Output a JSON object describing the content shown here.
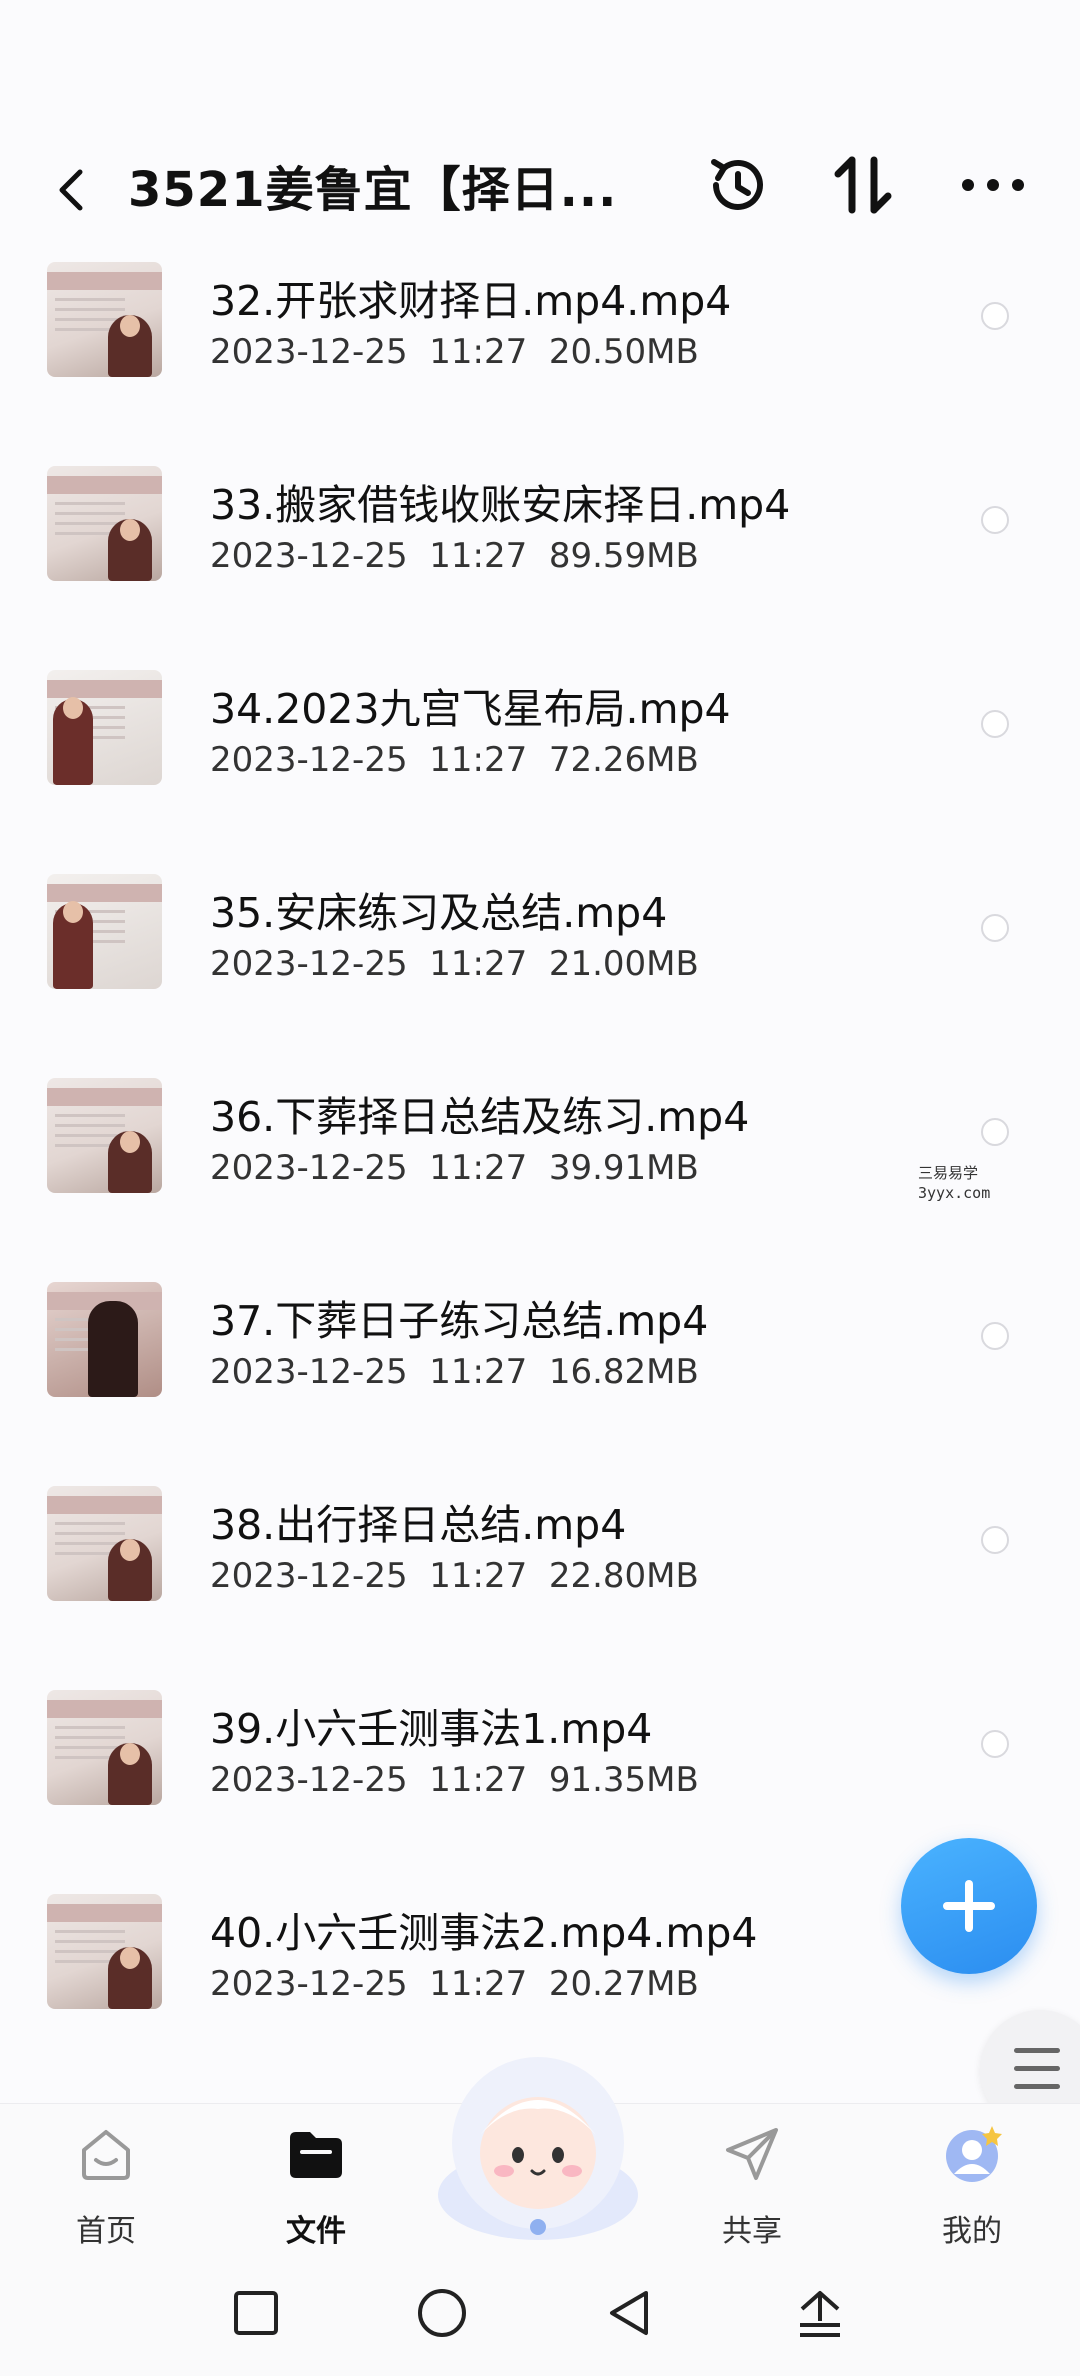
{
  "header": {
    "title": "3521姜鲁宜【择日..."
  },
  "files": [
    {
      "name": "32.开张求财择日.mp4.mp4",
      "date": "2023-12-25",
      "time": "11:27",
      "size": "20.50MB",
      "thumb": "slide"
    },
    {
      "name": "33.搬家借钱收账安床择日.mp4",
      "date": "2023-12-25",
      "time": "11:27",
      "size": "89.59MB",
      "thumb": "slide"
    },
    {
      "name": "34.2023九宫飞星布局.mp4",
      "date": "2023-12-25",
      "time": "11:27",
      "size": "72.26MB",
      "thumb": "board"
    },
    {
      "name": "35.安床练习及总结.mp4",
      "date": "2023-12-25",
      "time": "11:27",
      "size": "21.00MB",
      "thumb": "board"
    },
    {
      "name": "36.下葬择日总结及练习.mp4",
      "date": "2023-12-25",
      "time": "11:27",
      "size": "39.91MB",
      "thumb": "slide"
    },
    {
      "name": "37.下葬日子练习总结.mp4",
      "date": "2023-12-25",
      "time": "11:27",
      "size": "16.82MB",
      "thumb": "dark"
    },
    {
      "name": "38.出行择日总结.mp4",
      "date": "2023-12-25",
      "time": "11:27",
      "size": "22.80MB",
      "thumb": "slide"
    },
    {
      "name": "39.小六壬测事法1.mp4",
      "date": "2023-12-25",
      "time": "11:27",
      "size": "91.35MB",
      "thumb": "slide"
    },
    {
      "name": "40.小六壬测事法2.mp4.mp4",
      "date": "2023-12-25",
      "time": "11:27",
      "size": "20.27MB",
      "thumb": "slide"
    }
  ],
  "watermark": {
    "line1": "三易易学",
    "line2": "3yyx.com"
  },
  "tabs": [
    {
      "label": "首页",
      "icon": "home-icon"
    },
    {
      "label": "文件",
      "icon": "folder-icon",
      "active": true
    },
    {
      "label": "共享",
      "icon": "share-plane-icon"
    },
    {
      "label": "我的",
      "icon": "profile-icon"
    }
  ],
  "colors": {
    "accent": "#2b8df0",
    "text": "#111111",
    "meta": "#333333"
  }
}
